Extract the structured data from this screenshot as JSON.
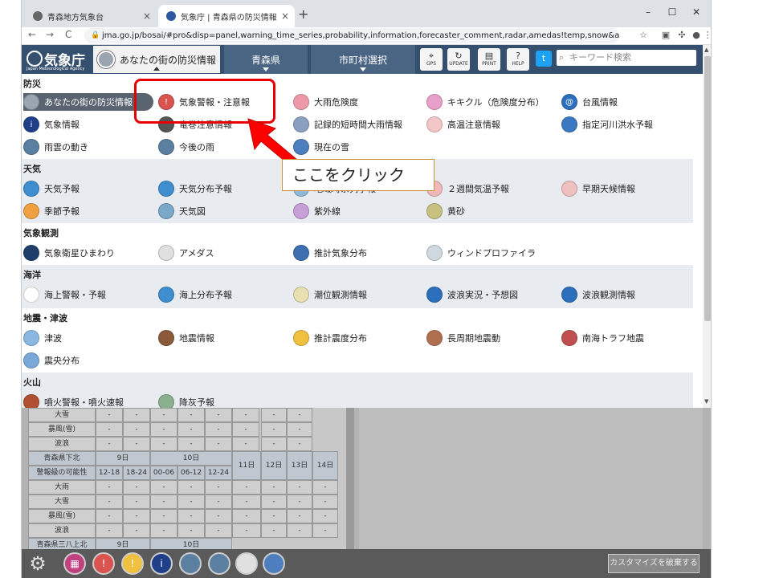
{
  "browser": {
    "tabs": [
      {
        "title": "青森地方気象台",
        "close": "×"
      },
      {
        "title": "気象庁 | 青森県の防災情報",
        "close": "×"
      }
    ],
    "new_tab": "+",
    "window_controls": {
      "minimize": "–",
      "maximize": "☐",
      "close": "✕"
    },
    "nav": {
      "back": "←",
      "forward": "→",
      "reload": "C"
    },
    "url": "jma.go.jp/bosai/#pro&disp=panel,warning_time_series,probability,information,forecaster_comment,radar,amedas!temp,snow&area_type=offices&a..."
  },
  "header": {
    "logo_text": "気象庁",
    "logo_en": "Japan Meteorological Agency",
    "home_label": "あなたの街の防災情報",
    "prefecture_label": "青森県",
    "city_label": "市町村選択",
    "buttons": [
      "GPS",
      "UPDATE",
      "PRINT",
      "HELP"
    ],
    "search_placeholder": "キーワード検索"
  },
  "menu": {
    "sections": [
      {
        "title": "防災",
        "items": [
          "あなたの街の防災情報",
          "気象警報・注意報",
          "大雨危険度",
          "キキクル（危険度分布）",
          "台風情報",
          "気象情報",
          "竜巻注意情報",
          "記録的短時間大雨情報",
          "高温注意情報",
          "指定河川洪水予報",
          "雨雲の動き",
          "今後の雨",
          "現在の雪"
        ]
      },
      {
        "title": "天気",
        "items": [
          "天気予報",
          "天気分布予報",
          "地域時系列予報",
          "２週間気温予報",
          "早期天候情報",
          "季節予報",
          "天気図",
          "紫外線",
          "黄砂"
        ]
      },
      {
        "title": "気象観測",
        "items": [
          "気象衛星ひまわり",
          "アメダス",
          "推計気象分布",
          "ウィンドプロファイラ"
        ]
      },
      {
        "title": "海洋",
        "items": [
          "海上警報・予報",
          "海上分布予報",
          "潮位観測情報",
          "波浪実況・予想図",
          "波浪観測情報"
        ]
      },
      {
        "title": "地震・津波",
        "items": [
          "津波",
          "地震情報",
          "推計震度分布",
          "長周期地震動",
          "南海トラフ地震",
          "震央分布"
        ]
      },
      {
        "title": "火山",
        "items": [
          "噴火警報・噴火速報",
          "降灰予報"
        ]
      }
    ]
  },
  "annotation": {
    "callout": "ここをクリック"
  },
  "table": {
    "rows_top": [
      {
        "label": "大雪",
        "cells": [
          "-",
          "-",
          "-",
          "-",
          "-",
          "-",
          "-",
          "-"
        ]
      },
      {
        "label": "暴風(雪)",
        "cells": [
          "-",
          "-",
          "-",
          "-",
          "-",
          "-",
          "-",
          "-"
        ]
      },
      {
        "label": "波浪",
        "cells": [
          "-",
          "-",
          "-",
          "-",
          "-",
          "-",
          "-",
          "-"
        ]
      }
    ],
    "region1": "青森県下北",
    "region2": "青森県三八上北",
    "day9": "9日",
    "day10": "10日",
    "day11": "11日",
    "day12": "12日",
    "day13": "13日",
    "day14": "14日",
    "possibility_label": "警報級の可能性",
    "times": [
      "12-18",
      "18-24",
      "00-06",
      "06-12",
      "12-24"
    ],
    "rows_bottom": [
      {
        "label": "大雨",
        "cells": [
          "-",
          "-",
          "-",
          "-",
          "-",
          "-",
          "-",
          "-",
          "-"
        ]
      },
      {
        "label": "大雪",
        "cells": [
          "-",
          "-",
          "-",
          "-",
          "-",
          "-",
          "-",
          "-",
          "-"
        ]
      },
      {
        "label": "暴風(雪)",
        "cells": [
          "-",
          "-",
          "-",
          "-",
          "-",
          "-",
          "-",
          "-",
          "-"
        ]
      },
      {
        "label": "波浪",
        "cells": [
          "-",
          "-",
          "-",
          "-",
          "-",
          "-",
          "-",
          "-",
          "-"
        ]
      }
    ]
  },
  "bottom_bar": {
    "destroy_label": "カスタマイズを破棄する"
  },
  "colors": {
    "header": "#35506e",
    "highlight": "#e60000",
    "callout_border": "#c8943a"
  }
}
